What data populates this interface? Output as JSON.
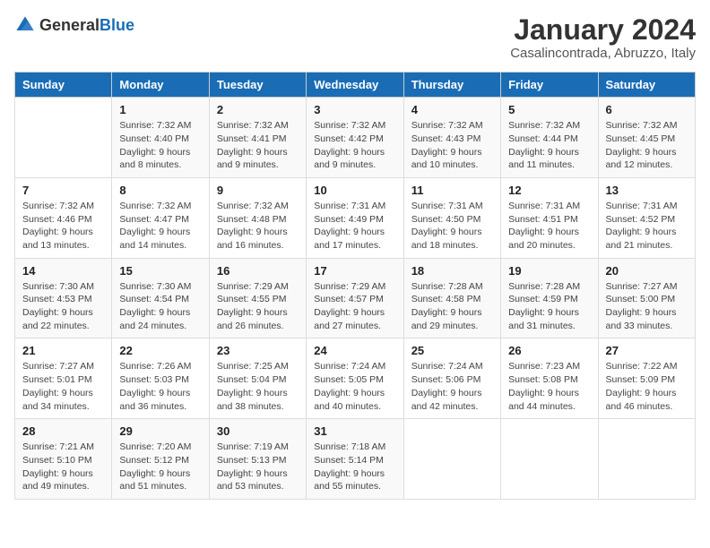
{
  "logo": {
    "general": "General",
    "blue": "Blue"
  },
  "calendar": {
    "title": "January 2024",
    "subtitle": "Casalincontrada, Abruzzo, Italy"
  },
  "weekdays": [
    "Sunday",
    "Monday",
    "Tuesday",
    "Wednesday",
    "Thursday",
    "Friday",
    "Saturday"
  ],
  "weeks": [
    [
      {
        "day": "",
        "info": ""
      },
      {
        "day": "1",
        "info": "Sunrise: 7:32 AM\nSunset: 4:40 PM\nDaylight: 9 hours\nand 8 minutes."
      },
      {
        "day": "2",
        "info": "Sunrise: 7:32 AM\nSunset: 4:41 PM\nDaylight: 9 hours\nand 9 minutes."
      },
      {
        "day": "3",
        "info": "Sunrise: 7:32 AM\nSunset: 4:42 PM\nDaylight: 9 hours\nand 9 minutes."
      },
      {
        "day": "4",
        "info": "Sunrise: 7:32 AM\nSunset: 4:43 PM\nDaylight: 9 hours\nand 10 minutes."
      },
      {
        "day": "5",
        "info": "Sunrise: 7:32 AM\nSunset: 4:44 PM\nDaylight: 9 hours\nand 11 minutes."
      },
      {
        "day": "6",
        "info": "Sunrise: 7:32 AM\nSunset: 4:45 PM\nDaylight: 9 hours\nand 12 minutes."
      }
    ],
    [
      {
        "day": "7",
        "info": "Sunrise: 7:32 AM\nSunset: 4:46 PM\nDaylight: 9 hours\nand 13 minutes."
      },
      {
        "day": "8",
        "info": "Sunrise: 7:32 AM\nSunset: 4:47 PM\nDaylight: 9 hours\nand 14 minutes."
      },
      {
        "day": "9",
        "info": "Sunrise: 7:32 AM\nSunset: 4:48 PM\nDaylight: 9 hours\nand 16 minutes."
      },
      {
        "day": "10",
        "info": "Sunrise: 7:31 AM\nSunset: 4:49 PM\nDaylight: 9 hours\nand 17 minutes."
      },
      {
        "day": "11",
        "info": "Sunrise: 7:31 AM\nSunset: 4:50 PM\nDaylight: 9 hours\nand 18 minutes."
      },
      {
        "day": "12",
        "info": "Sunrise: 7:31 AM\nSunset: 4:51 PM\nDaylight: 9 hours\nand 20 minutes."
      },
      {
        "day": "13",
        "info": "Sunrise: 7:31 AM\nSunset: 4:52 PM\nDaylight: 9 hours\nand 21 minutes."
      }
    ],
    [
      {
        "day": "14",
        "info": "Sunrise: 7:30 AM\nSunset: 4:53 PM\nDaylight: 9 hours\nand 22 minutes."
      },
      {
        "day": "15",
        "info": "Sunrise: 7:30 AM\nSunset: 4:54 PM\nDaylight: 9 hours\nand 24 minutes."
      },
      {
        "day": "16",
        "info": "Sunrise: 7:29 AM\nSunset: 4:55 PM\nDaylight: 9 hours\nand 26 minutes."
      },
      {
        "day": "17",
        "info": "Sunrise: 7:29 AM\nSunset: 4:57 PM\nDaylight: 9 hours\nand 27 minutes."
      },
      {
        "day": "18",
        "info": "Sunrise: 7:28 AM\nSunset: 4:58 PM\nDaylight: 9 hours\nand 29 minutes."
      },
      {
        "day": "19",
        "info": "Sunrise: 7:28 AM\nSunset: 4:59 PM\nDaylight: 9 hours\nand 31 minutes."
      },
      {
        "day": "20",
        "info": "Sunrise: 7:27 AM\nSunset: 5:00 PM\nDaylight: 9 hours\nand 33 minutes."
      }
    ],
    [
      {
        "day": "21",
        "info": "Sunrise: 7:27 AM\nSunset: 5:01 PM\nDaylight: 9 hours\nand 34 minutes."
      },
      {
        "day": "22",
        "info": "Sunrise: 7:26 AM\nSunset: 5:03 PM\nDaylight: 9 hours\nand 36 minutes."
      },
      {
        "day": "23",
        "info": "Sunrise: 7:25 AM\nSunset: 5:04 PM\nDaylight: 9 hours\nand 38 minutes."
      },
      {
        "day": "24",
        "info": "Sunrise: 7:24 AM\nSunset: 5:05 PM\nDaylight: 9 hours\nand 40 minutes."
      },
      {
        "day": "25",
        "info": "Sunrise: 7:24 AM\nSunset: 5:06 PM\nDaylight: 9 hours\nand 42 minutes."
      },
      {
        "day": "26",
        "info": "Sunrise: 7:23 AM\nSunset: 5:08 PM\nDaylight: 9 hours\nand 44 minutes."
      },
      {
        "day": "27",
        "info": "Sunrise: 7:22 AM\nSunset: 5:09 PM\nDaylight: 9 hours\nand 46 minutes."
      }
    ],
    [
      {
        "day": "28",
        "info": "Sunrise: 7:21 AM\nSunset: 5:10 PM\nDaylight: 9 hours\nand 49 minutes."
      },
      {
        "day": "29",
        "info": "Sunrise: 7:20 AM\nSunset: 5:12 PM\nDaylight: 9 hours\nand 51 minutes."
      },
      {
        "day": "30",
        "info": "Sunrise: 7:19 AM\nSunset: 5:13 PM\nDaylight: 9 hours\nand 53 minutes."
      },
      {
        "day": "31",
        "info": "Sunrise: 7:18 AM\nSunset: 5:14 PM\nDaylight: 9 hours\nand 55 minutes."
      },
      {
        "day": "",
        "info": ""
      },
      {
        "day": "",
        "info": ""
      },
      {
        "day": "",
        "info": ""
      }
    ]
  ]
}
